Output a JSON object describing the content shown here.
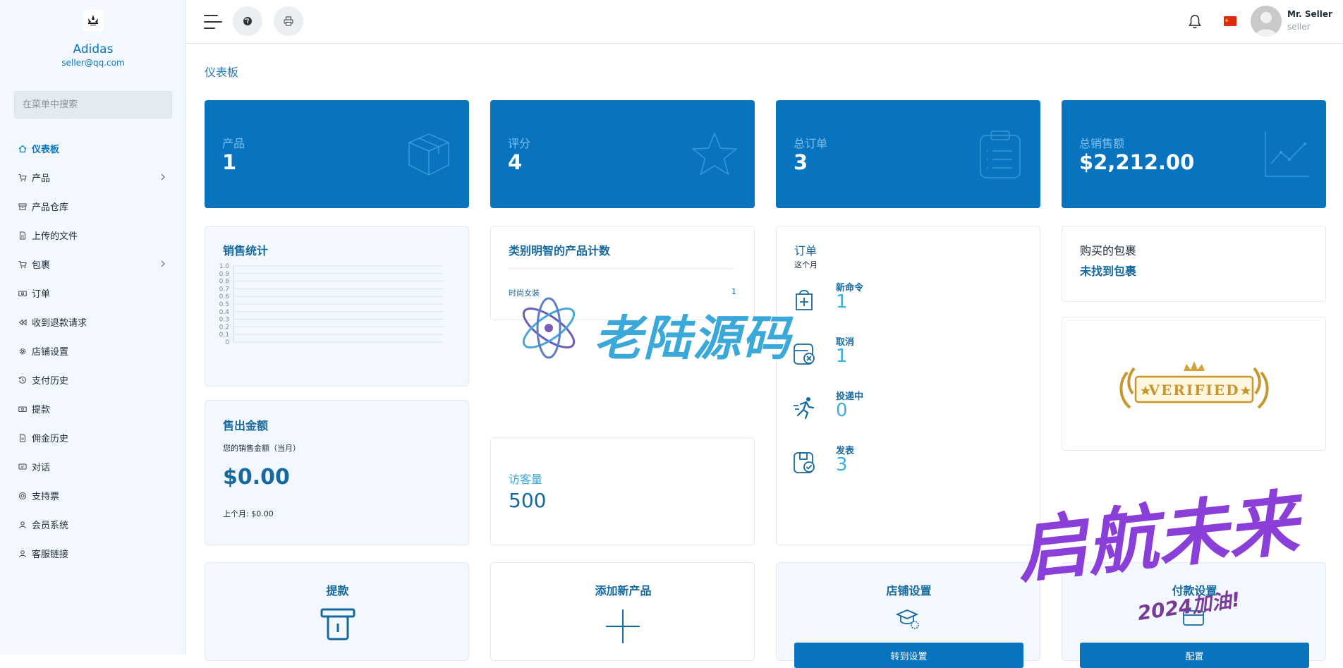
{
  "brand": {
    "name": "Adidas",
    "email": "seller@qq.com"
  },
  "menu_search": {
    "placeholder": "在菜单中搜索"
  },
  "nav": [
    {
      "label": "仪表板",
      "icon": "home-icon",
      "active": true
    },
    {
      "label": "产品",
      "icon": "cart-icon",
      "chevron": true
    },
    {
      "label": "产品仓库",
      "icon": "archive-icon"
    },
    {
      "label": "上传的文件",
      "icon": "file-icon"
    },
    {
      "label": "包裹",
      "icon": "cart-icon",
      "chevron": true
    },
    {
      "label": "订单",
      "icon": "money-icon"
    },
    {
      "label": "收到退款请求",
      "icon": "backward-icon"
    },
    {
      "label": "店铺设置",
      "icon": "gear-icon"
    },
    {
      "label": "支付历史",
      "icon": "history-icon"
    },
    {
      "label": "提款",
      "icon": "money-icon"
    },
    {
      "label": "佣金历史",
      "icon": "file-icon"
    },
    {
      "label": "对话",
      "icon": "chat-icon"
    },
    {
      "label": "支持票",
      "icon": "support-icon"
    },
    {
      "label": "会员系统",
      "icon": "user-icon"
    },
    {
      "label": "客服链接",
      "icon": "user-icon"
    }
  ],
  "user": {
    "name": "Mr. Seller",
    "role": "seller"
  },
  "page_title": "仪表板",
  "stats": [
    {
      "label": "产品",
      "value": "1",
      "icon": "box-icon"
    },
    {
      "label": "评分",
      "value": "4",
      "icon": "star-icon"
    },
    {
      "label": "总订单",
      "value": "3",
      "icon": "clipboard-icon"
    },
    {
      "label": "总销售额",
      "value": "$2,212.00",
      "icon": "chart-line-icon"
    }
  ],
  "sales_stats": {
    "title": "销售统计",
    "chart_data": {
      "type": "line",
      "y_ticks": [
        "1.0",
        "0.9",
        "0.8",
        "0.7",
        "0.6",
        "0.5",
        "0.4",
        "0.3",
        "0.2",
        "0.1",
        "0"
      ],
      "ylim": [
        0,
        1.0
      ],
      "series": []
    }
  },
  "category_count": {
    "title": "类别明智的产品计数",
    "rows": [
      {
        "name": "时尚女装",
        "count": "1"
      }
    ]
  },
  "sold_amount": {
    "title": "售出金额",
    "subtitle": "您的销售金额（当月）",
    "value": "$0.00",
    "last_month": "上个月: $0.00"
  },
  "visitors": {
    "label": "访客量",
    "value": "500"
  },
  "orders": {
    "title": "订单",
    "subtitle": "这个月",
    "items": [
      {
        "label": "新命令",
        "value": "1",
        "icon": "bag-plus-icon"
      },
      {
        "label": "取消",
        "value": "1",
        "icon": "cancel-box-icon"
      },
      {
        "label": "投递中",
        "value": "0",
        "icon": "running-icon"
      },
      {
        "label": "发表",
        "value": "3",
        "icon": "delivered-box-icon"
      }
    ]
  },
  "purchased_package": {
    "title": "购买的包裹",
    "value": "未找到包裹"
  },
  "verified_badge": {
    "text": "VERIFIED"
  },
  "quick_cards": [
    {
      "title": "提款",
      "icon": "withdraw-icon"
    },
    {
      "title": "添加新产品",
      "icon": "plus-icon"
    },
    {
      "title": "店铺设置",
      "icon": "shop-gear-icon",
      "button": "转到设置"
    },
    {
      "title": "付款设置",
      "icon": "payment-icon",
      "button": "配置"
    }
  ],
  "watermarks": {
    "logo_text": "老陆源码",
    "slogan": "启航未来",
    "slogan_sub": "2024加油!"
  }
}
